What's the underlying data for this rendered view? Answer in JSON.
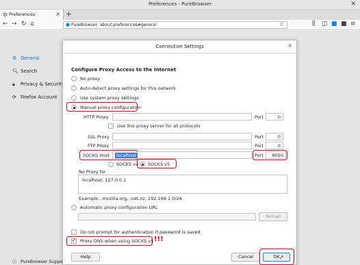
{
  "window": {
    "title": "Preferences - PureBrowser"
  },
  "tab": {
    "label": "Preferences"
  },
  "url": {
    "brand": "PureBrowser",
    "address": "about:preferences#general"
  },
  "sidebar": {
    "items": [
      {
        "label": "General"
      },
      {
        "label": "Search"
      },
      {
        "label": "Privacy & Security"
      },
      {
        "label": "Firefox Account"
      }
    ],
    "support": "PureBrowser Support"
  },
  "dialog": {
    "title": "Connection Settings",
    "section_heading": "Configure Proxy Access to the Internet",
    "options": {
      "no_proxy": "No proxy",
      "auto_detect": "Auto-detect proxy settings for this network",
      "system": "Use system proxy settings",
      "manual": "Manual proxy configuration",
      "auto_url": "Automatic proxy configuration URL"
    },
    "fields": {
      "http_label": "HTTP Proxy",
      "http_port": "0",
      "use_all_label": "Use this proxy server for all protocols",
      "ssl_label": "SSL Proxy",
      "ssl_port": "0",
      "ftp_label": "FTP Proxy",
      "ftp_port": "0",
      "socks_label": "SOCKS Host",
      "socks_host": "localhost",
      "socks_port": "9050",
      "port_label": "Port"
    },
    "socks_v4": "SOCKS v4",
    "socks_v5": "SOCKS v5",
    "no_proxy_for_label": "No Proxy for",
    "no_proxy_for_value": "localhost, 127.0.0.1",
    "example": "Example: .mozilla.org, .net.nz, 192.168.1.0/24",
    "reload": "Reload",
    "no_prompt_auth": "Do not prompt for authentication if password is saved",
    "proxy_dns": "Proxy DNS when using SOCKS v5",
    "warn_marks": "!!!",
    "help": "Help",
    "cancel": "Cancel",
    "ok": "OK"
  },
  "colors": {
    "accent": "#0a84ff",
    "annotation": "#d0021b"
  }
}
